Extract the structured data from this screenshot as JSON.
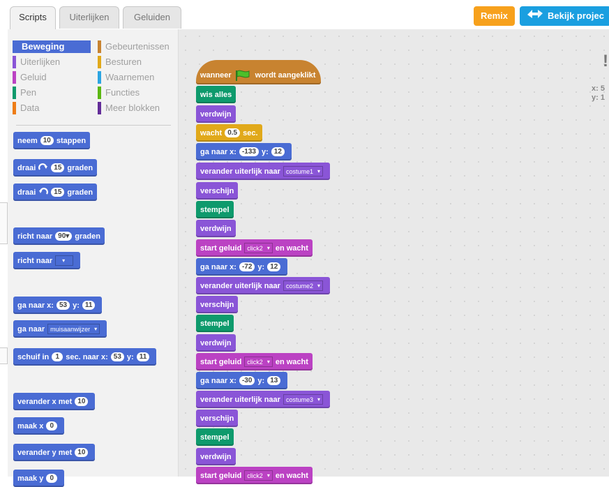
{
  "tabs": {
    "scripts": "Scripts",
    "costumes": "Uiterlijken",
    "sounds": "Geluiden"
  },
  "header": {
    "remix": "Remix",
    "see_project": "Bekijk projec"
  },
  "categories": {
    "motion": "Beweging",
    "looks": "Uiterlijken",
    "sound": "Geluid",
    "pen": "Pen",
    "data": "Data",
    "events": "Gebeurtenissen",
    "control": "Besturen",
    "sensing": "Waarnemen",
    "operators": "Functies",
    "more": "Meer blokken"
  },
  "colors": {
    "motion": "#4a6cd4",
    "looks": "#8a55d7",
    "sound": "#bb42c3",
    "pen": "#0e9a6c",
    "data": "#ee7d16",
    "events": "#c88330",
    "control": "#e1a91a",
    "sensing": "#2ca5e2",
    "operators": "#5cb712",
    "more": "#632d99",
    "remix": "#f7a11c",
    "see_project": "#1a9fe0"
  },
  "palette": {
    "move": {
      "a": "neem",
      "n": "10",
      "b": "stappen"
    },
    "turn_right": {
      "a": "draai",
      "n": "15",
      "b": "graden"
    },
    "turn_left": {
      "a": "draai",
      "n": "15",
      "b": "graden"
    },
    "point_dir": {
      "a": "richt naar",
      "n": "90",
      "b": "graden"
    },
    "point_towards": {
      "a": "richt naar"
    },
    "goto_xy": {
      "a": "ga naar x:",
      "x": "53",
      "b": "y:",
      "y": "11"
    },
    "goto": {
      "a": "ga naar",
      "dd": "muisaanwijzer"
    },
    "glide": {
      "a": "schuif in",
      "n": "1",
      "b": "sec. naar x:",
      "x": "53",
      "c": "y:",
      "y": "11"
    },
    "change_x": {
      "a": "verander x met",
      "n": "10"
    },
    "set_x": {
      "a": "maak x",
      "n": "0"
    },
    "change_y": {
      "a": "verander y met",
      "n": "10"
    },
    "set_y": {
      "a": "maak y",
      "n": "0"
    }
  },
  "script": {
    "hat": {
      "a": "wanneer",
      "b": "wordt aangeklikt"
    },
    "clear": "wis alles",
    "hide": "verdwijn",
    "wait": {
      "a": "wacht",
      "n": "0.5",
      "b": "sec."
    },
    "goto1": {
      "a": "ga naar x:",
      "x": "-133",
      "b": "y:",
      "y": "12"
    },
    "costume1": {
      "a": "verander uiterlijk naar",
      "dd": "costume1"
    },
    "show": "verschijn",
    "stamp": "stempel",
    "sound": {
      "a": "start geluid",
      "dd": "click2",
      "b": "en wacht"
    },
    "goto2": {
      "a": "ga naar x:",
      "x": "-72",
      "b": "y:",
      "y": "12"
    },
    "costume2": {
      "a": "verander uiterlijk naar",
      "dd": "costume2"
    },
    "goto3": {
      "a": "ga naar x:",
      "x": "-30",
      "b": "y:",
      "y": "13"
    },
    "costume3": {
      "a": "verander uiterlijk naar",
      "dd": "costume3"
    }
  },
  "stage": {
    "exclaim": "!",
    "x": "x: 5",
    "y": "y: 1"
  }
}
